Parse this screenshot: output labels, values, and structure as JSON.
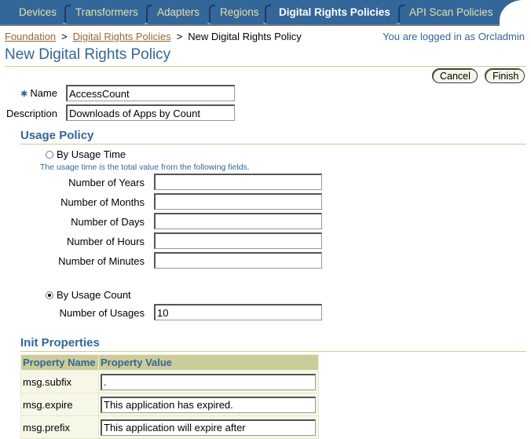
{
  "tabs": [
    {
      "label": "Devices",
      "active": false
    },
    {
      "label": "Transformers",
      "active": false
    },
    {
      "label": "Adapters",
      "active": false
    },
    {
      "label": "Regions",
      "active": false
    },
    {
      "label": "Digital Rights Policies",
      "active": true
    },
    {
      "label": "API Scan Policies",
      "active": false
    }
  ],
  "breadcrumb": {
    "items": [
      {
        "label": "Foundation",
        "link": true
      },
      {
        "label": "Digital Rights Policies",
        "link": true
      },
      {
        "label": "New Digital Rights Policy",
        "link": false
      }
    ],
    "separator": ">"
  },
  "login_info": "You are logged in as Orcladmin",
  "page_title": "New Digital Rights Policy",
  "buttons": {
    "cancel": "Cancel",
    "finish": "Finish"
  },
  "general": {
    "required_marker": "✱",
    "name_label": "Name",
    "name_value": "AccessCount",
    "description_label": "Description",
    "description_value": "Downloads of Apps by Count"
  },
  "usage_policy": {
    "title": "Usage Policy",
    "by_time": {
      "label": "By Usage Time",
      "selected": false,
      "hint": "The usage time is the total value from the following fields.",
      "fields": [
        {
          "label": "Number of Years",
          "value": ""
        },
        {
          "label": "Number of Months",
          "value": ""
        },
        {
          "label": "Number of Days",
          "value": ""
        },
        {
          "label": "Number of Hours",
          "value": ""
        },
        {
          "label": "Number of Minutes",
          "value": ""
        }
      ]
    },
    "by_count": {
      "label": "By Usage Count",
      "selected": true,
      "usages_label": "Number of Usages",
      "usages_value": "10"
    }
  },
  "init_properties": {
    "title": "Init Properties",
    "columns": [
      "Property Name",
      "Property Value"
    ],
    "rows": [
      {
        "name": "msg.subfix",
        "value": "."
      },
      {
        "name": "msg.expire",
        "value": "This application has expired."
      },
      {
        "name": "msg.prefix",
        "value": "This application will expire after"
      }
    ]
  },
  "colors": {
    "brand_blue": "#336699",
    "tab_text": "#e3e1a8",
    "link_brown": "#996633",
    "rule_khaki": "#cccc99"
  }
}
